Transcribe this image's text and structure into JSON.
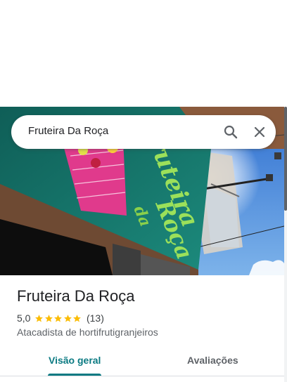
{
  "search": {
    "query": "Fruteira Da Roça",
    "search_icon": "search-icon",
    "close_icon": "close-icon"
  },
  "hero_photo": {
    "sign_text_line1": "Fruteira",
    "sign_text_line2": "da",
    "sign_text_line3": "Roça"
  },
  "place": {
    "name": "Fruteira Da Roça",
    "rating": "5,0",
    "stars": 5,
    "review_count": "(13)",
    "category": "Atacadista de hortifrutigranjeiros"
  },
  "tabs": [
    {
      "label": "Visão geral",
      "selected": true
    },
    {
      "label": "Avaliações",
      "selected": false
    }
  ],
  "colors": {
    "accent": "#0b7a82",
    "star": "#fbbc04",
    "text_primary": "#202124",
    "text_secondary": "#5f6368"
  }
}
